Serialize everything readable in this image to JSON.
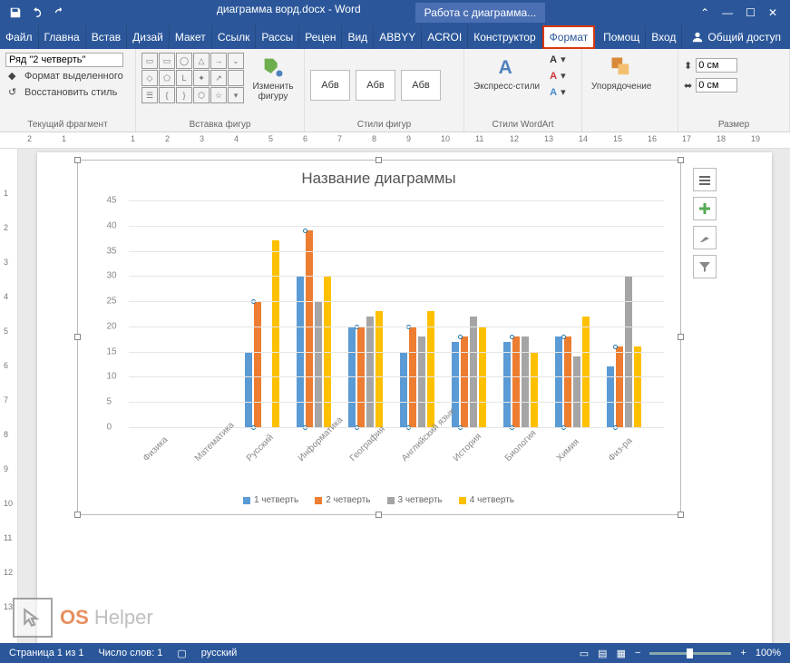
{
  "titlebar": {
    "doc_title": "диаграмма ворд.docx - Word",
    "tool_title": "Работа с диаграмма..."
  },
  "tabs": [
    "Файл",
    "Главна",
    "Встав",
    "Дизай",
    "Макет",
    "Ссылк",
    "Рассы",
    "Рецен",
    "Вид",
    "ABBYY",
    "ACROI",
    "Конструктор",
    "Формат"
  ],
  "tabs_right": [
    "Помощ",
    "Вход"
  ],
  "share_label": "Общий доступ",
  "ribbon": {
    "g1": {
      "select_value": "Ряд \"2 четверть\"",
      "btn_format_sel": "Формат выделенного",
      "btn_restore": "Восстановить стиль",
      "label": "Текущий фрагмент"
    },
    "g2": {
      "edit_shape": "Изменить фигуру",
      "label": "Вставка фигур"
    },
    "g3": {
      "style_text": "Абв",
      "label": "Стили фигур"
    },
    "g4": {
      "express": "Экспресс-стили",
      "label": "Стили WordArt"
    },
    "g5": {
      "arrange": "Упорядочение",
      "label": ""
    },
    "g6": {
      "h_val": "0 см",
      "w_val": "0 см",
      "label": "Размер"
    }
  },
  "ruler_h": [
    "2",
    "1",
    "",
    "1",
    "2",
    "3",
    "4",
    "5",
    "6",
    "7",
    "8",
    "9",
    "10",
    "11",
    "12",
    "13",
    "14",
    "15",
    "16",
    "17",
    "18",
    "19"
  ],
  "ruler_v": [
    "",
    "1",
    "2",
    "3",
    "4",
    "5",
    "6",
    "7",
    "8",
    "9",
    "10",
    "11",
    "12",
    "13"
  ],
  "chart_data": {
    "type": "bar",
    "title": "Название диаграммы",
    "categories": [
      "Физика",
      "Математика",
      "Русский",
      "Информатика",
      "География",
      "Английский язык",
      "История",
      "Биология",
      "Химия",
      "Физ-ра"
    ],
    "series": [
      {
        "name": "1 четверть",
        "color": "#5b9bd5",
        "values": [
          null,
          null,
          15,
          30,
          20,
          15,
          17,
          17,
          18,
          12
        ]
      },
      {
        "name": "2 четверть",
        "color": "#ed7d31",
        "values": [
          null,
          null,
          25,
          39,
          20,
          20,
          18,
          18,
          18,
          16
        ]
      },
      {
        "name": "3 четверть",
        "color": "#a5a5a5",
        "values": [
          null,
          null,
          null,
          25,
          22,
          18,
          22,
          18,
          14,
          30
        ]
      },
      {
        "name": "4 четверть",
        "color": "#ffc000",
        "values": [
          null,
          null,
          37,
          30,
          23,
          23,
          20,
          15,
          22,
          16
        ]
      }
    ],
    "ylabel": "",
    "xlabel": "",
    "ylim": [
      0,
      45
    ],
    "yticks": [
      0,
      5,
      10,
      15,
      20,
      25,
      30,
      35,
      40,
      45
    ],
    "selected_series_index": 1
  },
  "status": {
    "page": "Страница 1 из 1",
    "words": "Число слов: 1",
    "lang": "русский",
    "zoom": "100%"
  },
  "watermark": {
    "os": "OS",
    "helper": "Helper"
  }
}
